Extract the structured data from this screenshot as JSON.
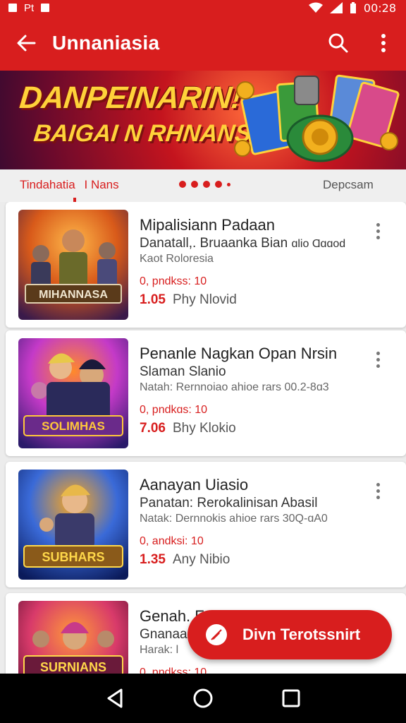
{
  "status_bar": {
    "left_text": "Pt",
    "time": "00:28"
  },
  "app_bar": {
    "title": "Unnaniasia"
  },
  "banner": {
    "line1": "DANPEINARIN!",
    "line2": "BAIGAI N RHNANS!"
  },
  "tabs": {
    "left": "Tindahatia",
    "left_secondary": "I Nans",
    "right": "Depcsam"
  },
  "cards": [
    {
      "title": "Mipalisiann Padaan",
      "subtitle": "Danatall,. Bruaanka Bian",
      "subtitle_tail": "ɑlio Ɑɑɑod",
      "meta": "Kaot Roloresia",
      "promo": "0, pndkss: 10",
      "price": "1.05",
      "price_unit": "Phy  Nlovid",
      "thumb_caption": "MIHANNASA",
      "colors": [
        "#3a1a4a",
        "#d85a1a",
        "#ffb84a"
      ]
    },
    {
      "title": "Penanle Nagkan Opan Nrsin",
      "subtitle": "Slaman Slanio",
      "meta": "Natah: Rernnoiao ahioe rars 00.2-8ɑ3",
      "promo": "0, pndkɑs: 10",
      "price": "7.06",
      "price_unit": "Bhy  Klokio",
      "thumb_caption": "SOLIMHAS",
      "colors": [
        "#2a1a6a",
        "#c43ac8",
        "#ff8a2a"
      ]
    },
    {
      "title": "Aanayan Uiasio",
      "subtitle": "Panatan: Rerokalinisan Abasil",
      "meta": "Natak: Dernnokis ahioe rars 30Q-ɑA0",
      "promo": "0, andksi: 10",
      "price": "1.35",
      "price_unit": "Any  Nibio",
      "thumb_caption": "SUBHARS",
      "colors": [
        "#0a1a5a",
        "#3a6ad8",
        "#ffa81a"
      ]
    },
    {
      "title": "Genah. F",
      "subtitle": "Gnanaa",
      "meta": "Harak: l",
      "promo": "0, pndkss: 10",
      "price": "",
      "price_unit": "",
      "thumb_caption": "SURNIANS",
      "colors": [
        "#4a0a2a",
        "#d83a6a",
        "#ff9a3a"
      ]
    }
  ],
  "fab": {
    "label": "Divn Terotssnirt",
    "icon": "no-edit-icon"
  },
  "nav_bar": {
    "back": "back-triangle-icon",
    "home": "home-circle-icon",
    "recents": "recents-square-icon"
  },
  "accent_color": "#d81e1e"
}
